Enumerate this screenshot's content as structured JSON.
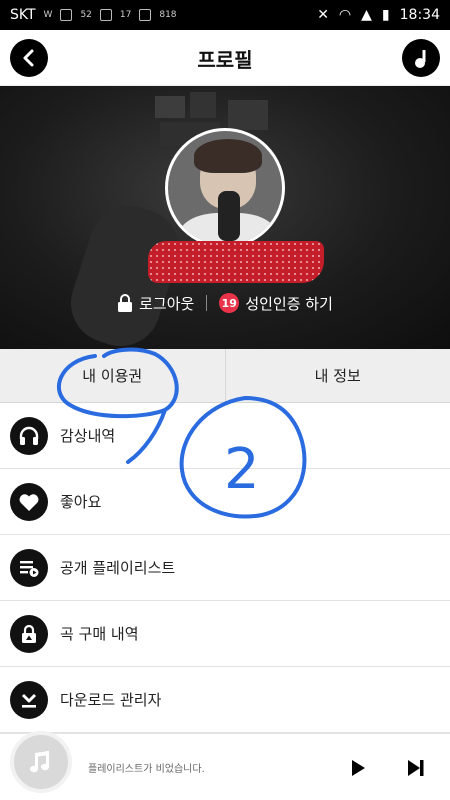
{
  "status_bar": {
    "carrier": "SKT",
    "indicators_left": [
      "W",
      "52",
      "17",
      "818"
    ],
    "time": "18:34"
  },
  "header": {
    "title": "프로필",
    "back_icon": "chevron-left-icon",
    "music_icon": "music-note-icon"
  },
  "profile": {
    "logout_label": "로그아웃",
    "adult_badge": "19",
    "adult_verify_label": "성인인증 하기"
  },
  "tabs": [
    {
      "label": "내 이용권"
    },
    {
      "label": "내 정보"
    }
  ],
  "menu": [
    {
      "label": "감상내역",
      "icon": "headphones-icon"
    },
    {
      "label": "좋아요",
      "icon": "heart-icon"
    },
    {
      "label": "공개 플레이리스트",
      "icon": "playlist-icon"
    },
    {
      "label": "곡 구매 내역",
      "icon": "lock-icon"
    },
    {
      "label": "다운로드 관리자",
      "icon": "download-icon"
    }
  ],
  "player": {
    "status_text": "플레이리스트가 비었습니다.",
    "play_icon": "play-icon",
    "next_icon": "next-track-icon"
  },
  "annotations": {
    "circled_number": "2"
  },
  "colors": {
    "header_bg": "#ffffff",
    "icon_bg": "#111111",
    "badge_red": "#e8334a",
    "scribble_blue": "#2a6be0",
    "redaction_red": "#c41e2a"
  }
}
